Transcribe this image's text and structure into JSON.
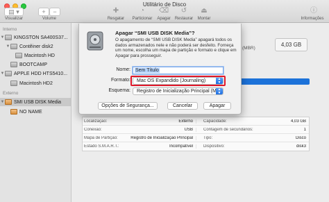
{
  "window": {
    "title": "Utilitário de Disco"
  },
  "toolbar": {
    "view_label": "Visualizar",
    "volume_label": "Volume",
    "volume_add": "+",
    "volume_remove": "−",
    "rescue_label": "Resgatar",
    "partition_label": "Particionar",
    "erase_label": "Apagar",
    "restore_label": "Restaurar",
    "mount_label": "Montar",
    "info_label": "Informações"
  },
  "sidebar": {
    "internal_header": "Interno",
    "external_header": "Externo",
    "items": [
      {
        "label": "KINGSTON SA400S37...",
        "level": 0,
        "expanded": true
      },
      {
        "label": "Contêiner disk2",
        "level": 1,
        "expanded": true
      },
      {
        "label": "Macintosh HD",
        "level": 2
      },
      {
        "label": "BOOTCAMP",
        "level": 1
      },
      {
        "label": "APPLE HDD HTS5410...",
        "level": 0,
        "expanded": true
      },
      {
        "label": "Macintosh HD2",
        "level": 1
      },
      {
        "label": "SMI USB DISK Media",
        "level": 0,
        "expanded": true,
        "selected": true
      },
      {
        "label": "NO NAME",
        "level": 1
      }
    ]
  },
  "main": {
    "capacity": "4,03 GB",
    "scheme_visible": "(MBR)"
  },
  "info_table": {
    "rows": [
      {
        "l1": "Localização:",
        "v1": "Externo",
        "l2": "Capacidade:",
        "v2": "4,03 GB"
      },
      {
        "l1": "Conexão:",
        "v1": "USB",
        "l2": "Contagem de secundários:",
        "v2": "1"
      },
      {
        "l1": "Mapa de Partição:",
        "v1": "Registro de Inicialização Principal",
        "l2": "Tipo:",
        "v2": "Disco"
      },
      {
        "l1": "Estado S.M.A.R.T.:",
        "v1": "Incompatível",
        "l2": "Dispositivo:",
        "v2": "disk3"
      }
    ]
  },
  "dialog": {
    "title": "Apagar “SMI USB DISK Media”?",
    "message": "O apagamento de “SMI USB DISK Media” apagará todos os dados armazenados nele e não poderá ser desfeito. Forneça um nome, escolha um mapa de partição e formato e clique em Apagar para prosseguir.",
    "name_label": "Nome:",
    "name_value": "Sem Título",
    "format_label": "Formato:",
    "format_value": "Mac OS Expandido (Journaling)",
    "scheme_label": "Esquema:",
    "scheme_value": "Registro de Inicialização Principal (M...",
    "security_button": "Opções de Segurança...",
    "cancel_button": "Cancelar",
    "erase_button": "Apagar"
  },
  "colors": {
    "accent": "#1c72d9",
    "highlight_box": "#e0182a"
  }
}
